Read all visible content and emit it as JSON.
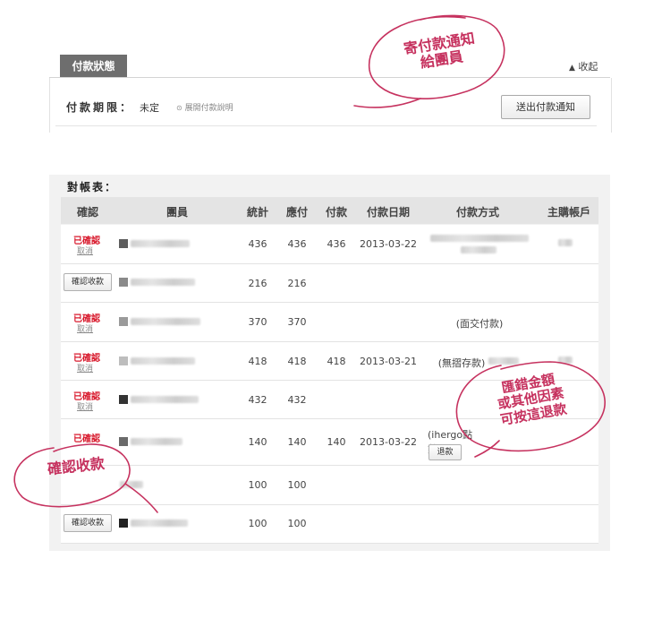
{
  "payment_status": {
    "tab_label": "付款狀態",
    "collapse_label": "收起",
    "deadline_label": "付款期限：",
    "deadline_value": "未定",
    "expand_link": "展開付款說明",
    "send_button": "送出付款通知"
  },
  "reconciliation": {
    "title": "對帳表：",
    "columns": [
      "確認",
      "團員",
      "統計",
      "應付",
      "付款",
      "付款日期",
      "付款方式",
      "主購帳戶"
    ],
    "confirmed_label": "已確認",
    "cancel_label": "取消",
    "confirm_button": "確認收款",
    "refund_button": "退款",
    "rows": [
      {
        "status": "confirmed",
        "total": "436",
        "due": "436",
        "paid": "436",
        "date": "2013-03-22",
        "method": ""
      },
      {
        "status": "pending",
        "total": "216",
        "due": "216",
        "paid": "",
        "date": "",
        "method": ""
      },
      {
        "status": "confirmed",
        "total": "370",
        "due": "370",
        "paid": "",
        "date": "",
        "method": "(面交付款)"
      },
      {
        "status": "confirmed",
        "total": "418",
        "due": "418",
        "paid": "418",
        "date": "2013-03-21",
        "method": "(無摺存款)"
      },
      {
        "status": "confirmed",
        "total": "432",
        "due": "432",
        "paid": "",
        "date": "",
        "method": ""
      },
      {
        "status": "confirmed",
        "total": "140",
        "due": "140",
        "paid": "140",
        "date": "2013-03-22",
        "method": "(ihergo點數"
      },
      {
        "status": "none",
        "total": "100",
        "due": "100",
        "paid": "",
        "date": "",
        "method": ""
      },
      {
        "status": "pending",
        "total": "100",
        "due": "100",
        "paid": "",
        "date": "",
        "method": ""
      }
    ]
  },
  "annotations": {
    "send_notice": [
      "寄付款通知",
      "給團員"
    ],
    "confirm_receipt": "確認收款",
    "refund_note": [
      "匯錯金額",
      "或其他因素",
      "可按這退款"
    ]
  },
  "colors": {
    "annotation": "#c6325f",
    "confirmed_red": "#d8192c",
    "tab_gray": "#6e6e6e",
    "header_gray": "#e4e4e4"
  },
  "icons": {
    "collapse": "triangle-up-icon",
    "expand": "circle-dot-icon"
  }
}
